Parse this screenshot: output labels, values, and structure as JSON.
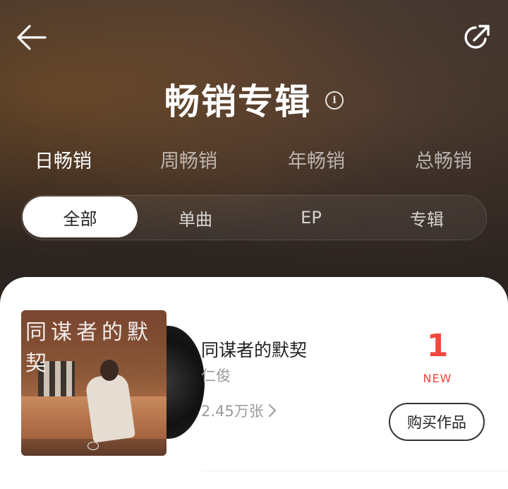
{
  "header": {
    "title": "畅销专辑",
    "info_icon": "info-icon",
    "back_icon": "arrow-left-icon",
    "share_icon": "share-icon"
  },
  "period_tabs": [
    {
      "label": "日畅销",
      "active": true
    },
    {
      "label": "周畅销",
      "active": false
    },
    {
      "label": "年畅销",
      "active": false
    },
    {
      "label": "总畅销",
      "active": false
    }
  ],
  "type_tabs": [
    {
      "label": "全部",
      "active": true
    },
    {
      "label": "单曲",
      "active": false
    },
    {
      "label": "EP",
      "active": false
    },
    {
      "label": "专辑",
      "active": false
    }
  ],
  "albums": [
    {
      "title": "同谋者的默契",
      "artist": "仁俊",
      "sales": "2.45万张",
      "rank": "1",
      "badge": "NEW",
      "buy_label": "购买作品",
      "cover_text": "同谋者的默契"
    }
  ],
  "colors": {
    "accent": "#f0473e",
    "active_tab_bg": "#ffffff"
  }
}
